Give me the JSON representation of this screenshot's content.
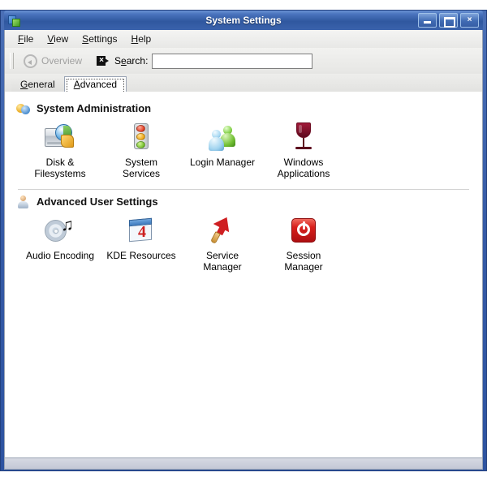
{
  "window": {
    "title": "System Settings",
    "icon": "system-settings-icon",
    "buttons": [
      {
        "name": "minimize-button",
        "label": ""
      },
      {
        "name": "maximize-button",
        "label": ""
      },
      {
        "name": "close-button",
        "label": "×"
      }
    ]
  },
  "menubar": {
    "items": [
      {
        "mnemonic": "F",
        "rest": "ile"
      },
      {
        "mnemonic": "V",
        "rest": "iew"
      },
      {
        "mnemonic": "S",
        "rest": "ettings"
      },
      {
        "mnemonic": "H",
        "rest": "elp"
      }
    ]
  },
  "toolbar": {
    "overview_label": "Overview",
    "overview_icon": "back-arrow-icon",
    "clear_icon": "clear-search-icon",
    "search_label_pre": "S",
    "search_label_mnemonic": "e",
    "search_label_post": "arch:",
    "search_value": "",
    "search_placeholder": ""
  },
  "tabs": [
    {
      "name": "tab-general",
      "mnemonic": "G",
      "rest": "eneral",
      "active": false
    },
    {
      "name": "tab-advanced",
      "mnemonic": "A",
      "rest": "dvanced",
      "active": true
    }
  ],
  "groups": [
    {
      "title": "System Administration",
      "icon": "admin-spheres-icon",
      "items": [
        {
          "icon": "disk-filesystems-icon",
          "line1": "Disk &",
          "line2": "Filesystems"
        },
        {
          "icon": "traffic-light-icon",
          "line1": "System",
          "line2": "Services"
        },
        {
          "icon": "two-users-icon",
          "line1": "Login Manager",
          "line2": ""
        },
        {
          "icon": "wine-glass-icon",
          "line1": "Windows",
          "line2": "Applications"
        }
      ]
    },
    {
      "title": "Advanced User Settings",
      "icon": "user-person-icon",
      "items": [
        {
          "icon": "audio-cd-note-icon",
          "line1": "Audio Encoding",
          "line2": ""
        },
        {
          "icon": "kde-resources-icon",
          "line1": "KDE Resources",
          "line2": ""
        },
        {
          "icon": "service-arrow-icon",
          "line1": "Service",
          "line2": "Manager"
        },
        {
          "icon": "power-button-icon",
          "line1": "Session",
          "line2": "Manager"
        }
      ]
    }
  ],
  "colors": {
    "titlebar": "#3a62ac",
    "window_border": "#2d53a0",
    "content_bg": "#ffffff",
    "toolbar_bg": "#ededeb"
  }
}
